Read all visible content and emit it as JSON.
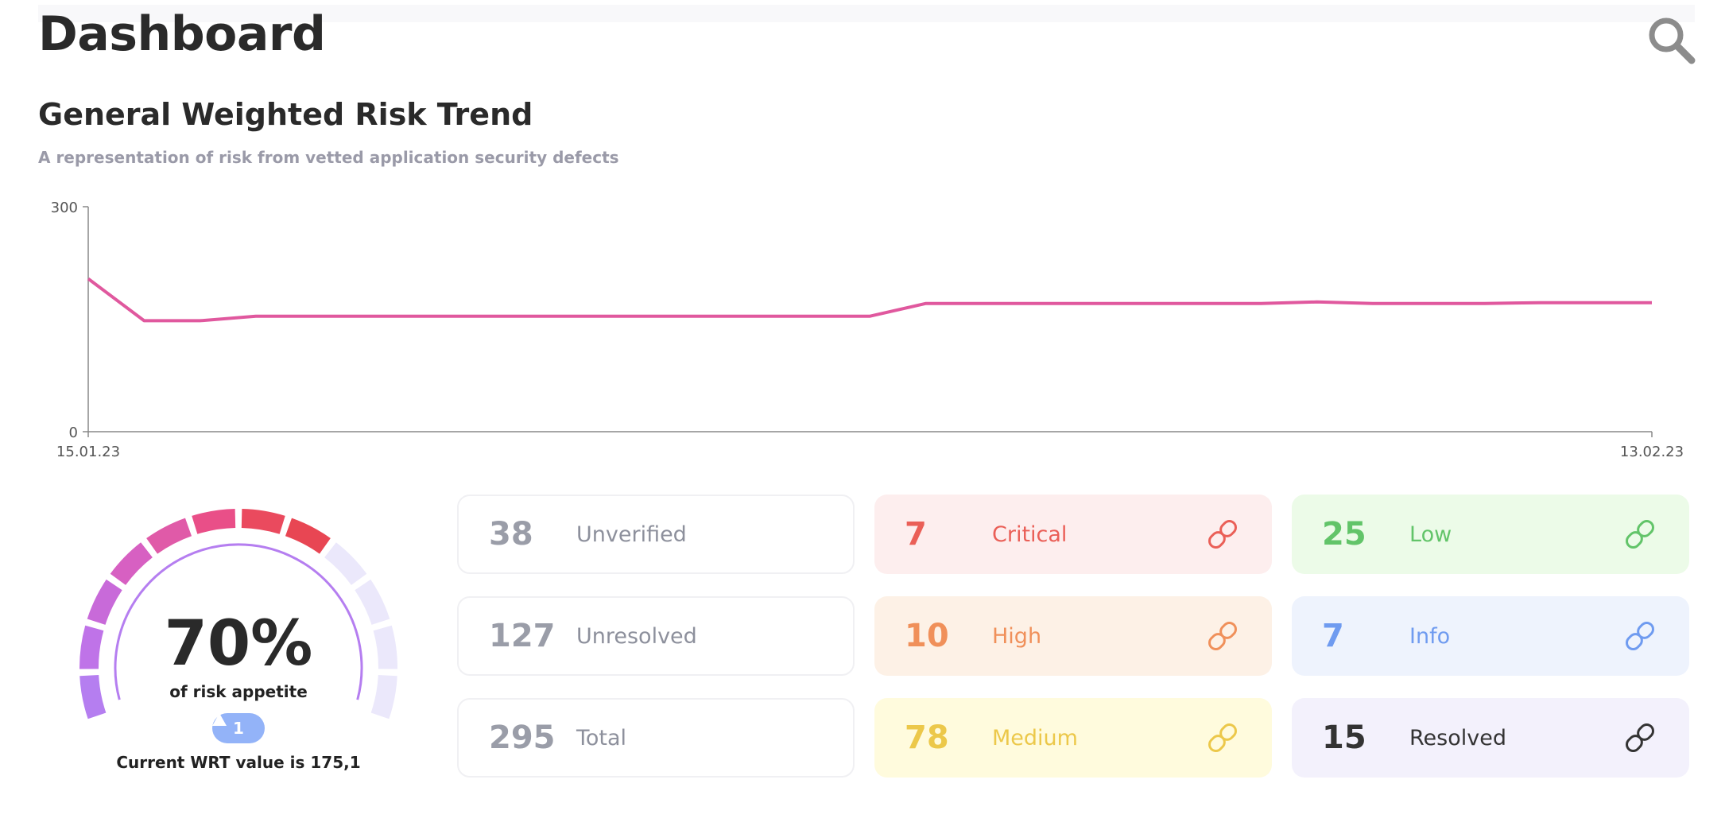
{
  "header": {
    "title": "Dashboard"
  },
  "icons": {
    "search": "search-icon",
    "link": "link-icon",
    "trend_up": "triangle-up-icon"
  },
  "trend": {
    "title": "General Weighted Risk Trend",
    "subtitle": "A representation of risk from vetted application security defects",
    "line_color": "#e0589e"
  },
  "chart_data": {
    "type": "line",
    "title": "General Weighted Risk Trend",
    "xlabel": "",
    "ylabel": "",
    "x_tick_labels": [
      "15.01.23",
      "13.02.23"
    ],
    "y_tick_labels": [
      "0",
      "300"
    ],
    "ylim": [
      0,
      300
    ],
    "grid": false,
    "series": [
      {
        "values": [
          204,
          148,
          148,
          154,
          154,
          154,
          154,
          154,
          154,
          154,
          154,
          154,
          154,
          154,
          154,
          171,
          171,
          171,
          171,
          171,
          171,
          171,
          173,
          171,
          171,
          171,
          172,
          172,
          172
        ]
      }
    ]
  },
  "gauge": {
    "value": "70%",
    "fraction": 0.7,
    "caption": "of risk appetite",
    "change": "1",
    "current": "Current WRT value is 175,1"
  },
  "stats": [
    {
      "number": "38",
      "label": "Unverified",
      "num_color": "#9a9da8",
      "label_color": "#8d909c",
      "bg": "#ffffff",
      "link": false
    },
    {
      "number": "127",
      "label": "Unresolved",
      "num_color": "#9a9da8",
      "label_color": "#8d909c",
      "bg": "#ffffff",
      "link": false
    },
    {
      "number": "295",
      "label": "Total",
      "num_color": "#9a9da8",
      "label_color": "#8d909c",
      "bg": "#ffffff",
      "link": false
    },
    {
      "number": "7",
      "label": "Critical",
      "num_color": "#ea5f57",
      "label_color": "#ea5f57",
      "bg": "#fdeeee",
      "link": true
    },
    {
      "number": "10",
      "label": "High",
      "num_color": "#f0905a",
      "label_color": "#f0905a",
      "bg": "#fdf1e6",
      "link": true
    },
    {
      "number": "78",
      "label": "Medium",
      "num_color": "#ecc84a",
      "label_color": "#ecc84a",
      "bg": "#fffbdd",
      "link": true
    },
    {
      "number": "25",
      "label": "Low",
      "num_color": "#62c469",
      "label_color": "#62c469",
      "bg": "#ecfbe8",
      "link": true
    },
    {
      "number": "7",
      "label": "Info",
      "num_color": "#6f9bf0",
      "label_color": "#6f9bf0",
      "bg": "#eef3fd",
      "link": true
    },
    {
      "number": "15",
      "label": "Resolved",
      "num_color": "#333333",
      "label_color": "#333333",
      "bg": "#f3f1fc",
      "link": true
    }
  ]
}
